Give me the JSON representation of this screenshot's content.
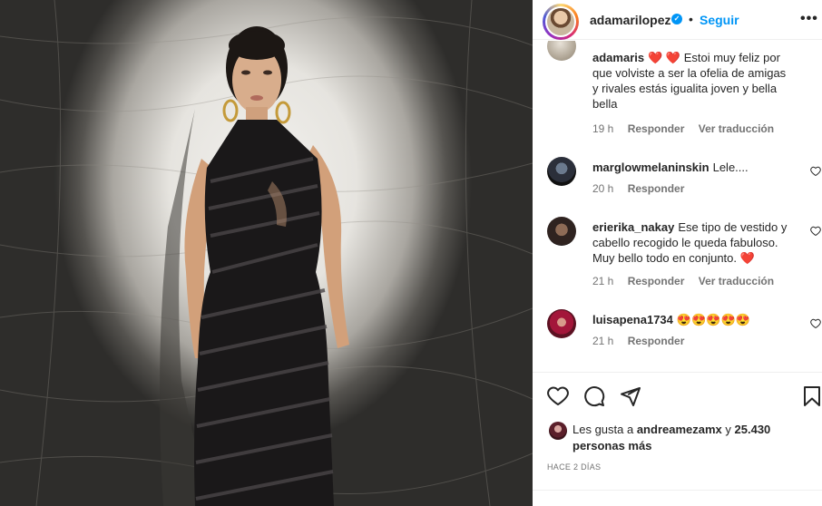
{
  "post": {
    "username": "adamarilopez",
    "verified": true,
    "separator": "•",
    "follow_label": "Seguir",
    "more_label": "•••",
    "photo_description_icon": "post-photo"
  },
  "comments": [
    {
      "user": "adamaris",
      "text_after_hearts": "Estoi muy feliz por que volviste a ser la ofelia de amigas y rivales estás igualita joven y bella bella",
      "hearts": "❤️ ❤️",
      "time": "19 h",
      "reply_label": "Responder",
      "translate_label": "Ver traducción"
    },
    {
      "user": "marglowmelaninskin",
      "text": "Lele....",
      "time": "20 h",
      "reply_label": "Responder"
    },
    {
      "user": "erierika_nakay",
      "text": "Ese tipo de vestido y cabello recogido le queda fabuloso. Muy bello todo en conjunto.",
      "trailing_heart": "❤️",
      "time": "21 h",
      "reply_label": "Responder",
      "translate_label": "Ver traducción"
    },
    {
      "user": "luisapena1734",
      "text": "😍😍😍😍😍",
      "time": "21 h",
      "reply_label": "Responder"
    }
  ],
  "actions": {
    "like_icon": "heart-icon",
    "comment_icon": "comment-icon",
    "share_icon": "share-icon",
    "save_icon": "bookmark-icon"
  },
  "likes": {
    "prefix": "Les gusta a ",
    "user": "andreamezamx",
    "middle": " y ",
    "count": "25.430",
    "suffix": "personas más"
  },
  "time_ago": "Hace 2 días",
  "colors": {
    "accent": "#0095f6",
    "text": "#262626",
    "muted": "#737373",
    "heart": "#ed4956"
  }
}
